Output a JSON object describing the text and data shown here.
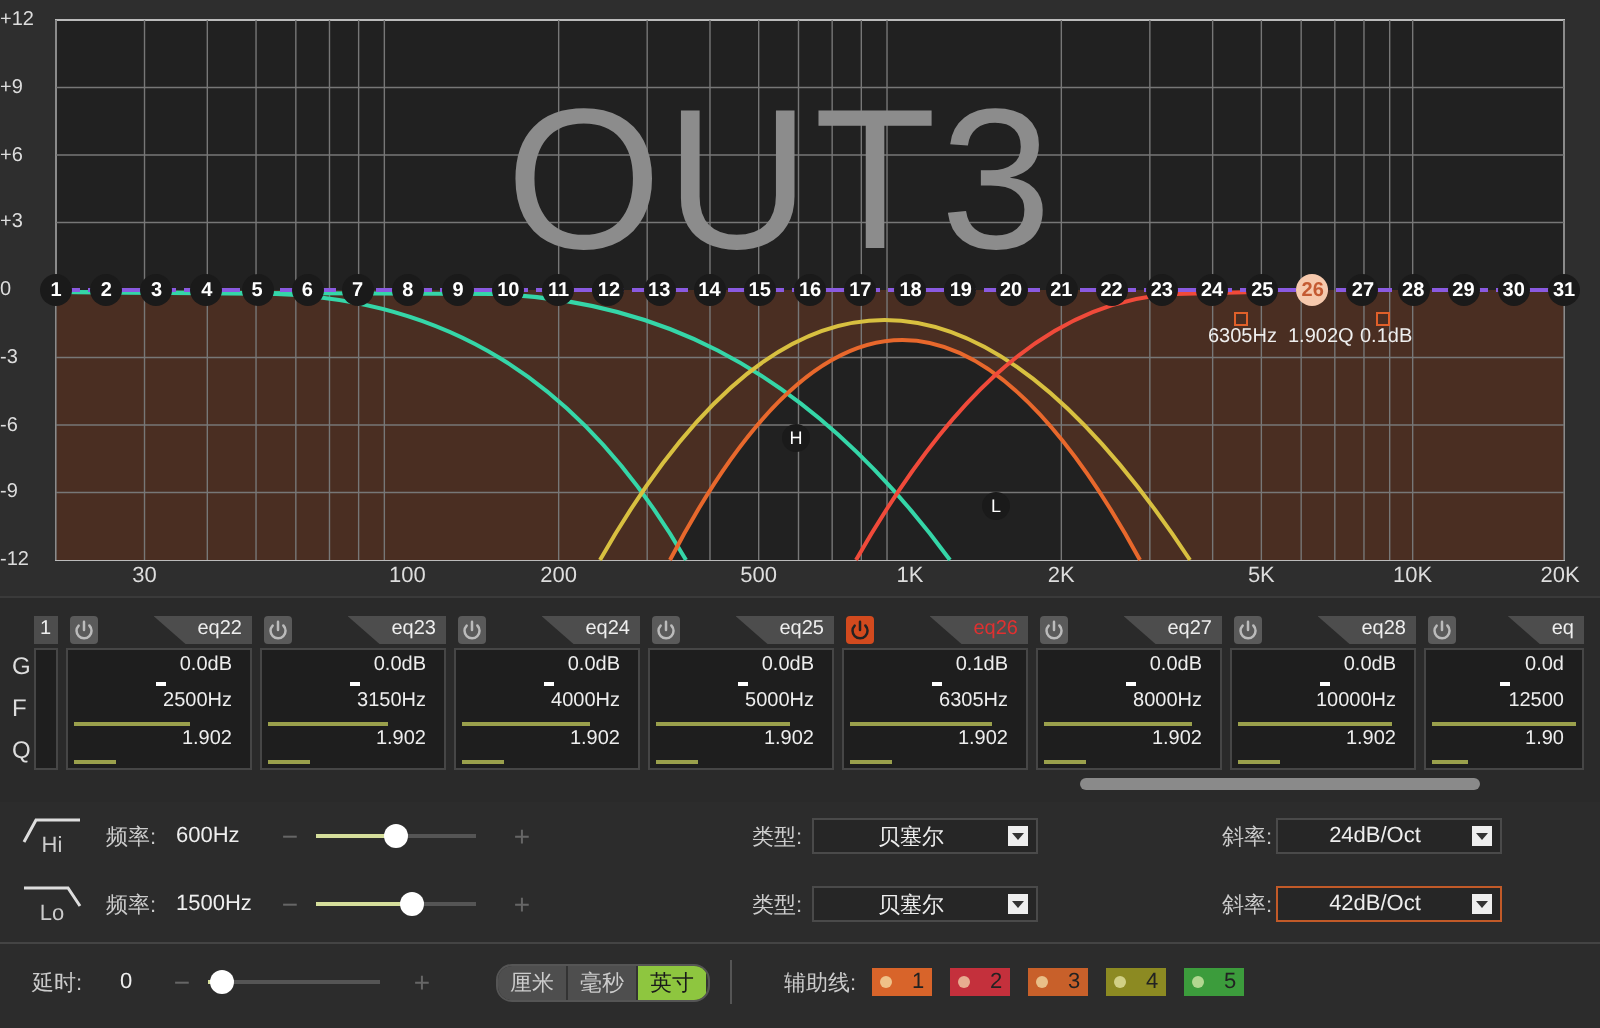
{
  "graph": {
    "channel_label": "OUT3",
    "y_ticks": [
      "+12",
      "+9",
      "+6",
      "+3",
      "0",
      "-3",
      "-6",
      "-9",
      "-12"
    ],
    "x_ticks": [
      "30",
      "100",
      "200",
      "500",
      "1K",
      "2K",
      "5K",
      "10K",
      "20K"
    ],
    "nodes": [
      {
        "label": "1",
        "selected": false
      },
      {
        "label": "2",
        "selected": false
      },
      {
        "label": "3",
        "selected": false
      },
      {
        "label": "4",
        "selected": false
      },
      {
        "label": "5",
        "selected": false
      },
      {
        "label": "6",
        "selected": false
      },
      {
        "label": "7",
        "selected": false
      },
      {
        "label": "8",
        "selected": false
      },
      {
        "label": "9",
        "selected": false
      },
      {
        "label": "10",
        "selected": false
      },
      {
        "label": "11",
        "selected": false
      },
      {
        "label": "12",
        "selected": false
      },
      {
        "label": "13",
        "selected": false
      },
      {
        "label": "14",
        "selected": false
      },
      {
        "label": "15",
        "selected": false
      },
      {
        "label": "16",
        "selected": false
      },
      {
        "label": "17",
        "selected": false
      },
      {
        "label": "18",
        "selected": false
      },
      {
        "label": "19",
        "selected": false
      },
      {
        "label": "20",
        "selected": false
      },
      {
        "label": "21",
        "selected": false
      },
      {
        "label": "22",
        "selected": false
      },
      {
        "label": "23",
        "selected": false
      },
      {
        "label": "24",
        "selected": false
      },
      {
        "label": "25",
        "selected": false
      },
      {
        "label": "26",
        "selected": true
      },
      {
        "label": "27",
        "selected": false
      },
      {
        "label": "28",
        "selected": false
      },
      {
        "label": "29",
        "selected": false
      },
      {
        "label": "30",
        "selected": false
      },
      {
        "label": "31",
        "selected": false
      }
    ],
    "readout": [
      "6305Hz",
      "1.902Q",
      "0.1dB"
    ],
    "markers": [
      {
        "label": "H"
      },
      {
        "label": "L"
      }
    ]
  },
  "eq_strip": {
    "row_labels": [
      "G",
      "F",
      "Q"
    ],
    "bands": [
      {
        "kind": "partial",
        "tab": "1"
      },
      {
        "kind": "full",
        "tab": "eq22",
        "selected": false,
        "gain": {
          "text": "0.0dB",
          "level": 0.5
        },
        "freq": {
          "text": "2500Hz",
          "level": 0.68
        },
        "q": {
          "text": "1.902",
          "level": 0.25
        }
      },
      {
        "kind": "full",
        "tab": "eq23",
        "selected": false,
        "gain": {
          "text": "0.0dB",
          "level": 0.5
        },
        "freq": {
          "text": "3150Hz",
          "level": 0.71
        },
        "q": {
          "text": "1.902",
          "level": 0.25
        }
      },
      {
        "kind": "full",
        "tab": "eq24",
        "selected": false,
        "gain": {
          "text": "0.0dB",
          "level": 0.5
        },
        "freq": {
          "text": "4000Hz",
          "level": 0.75
        },
        "q": {
          "text": "1.902",
          "level": 0.25
        }
      },
      {
        "kind": "full",
        "tab": "eq25",
        "selected": false,
        "gain": {
          "text": "0.0dB",
          "level": 0.5
        },
        "freq": {
          "text": "5000Hz",
          "level": 0.79
        },
        "q": {
          "text": "1.902",
          "level": 0.25
        }
      },
      {
        "kind": "full",
        "tab": "eq26",
        "selected": true,
        "gain": {
          "text": "0.1dB",
          "level": 0.5
        },
        "freq": {
          "text": "6305Hz",
          "level": 0.83
        },
        "q": {
          "text": "1.902",
          "level": 0.25
        }
      },
      {
        "kind": "full",
        "tab": "eq27",
        "selected": false,
        "gain": {
          "text": "0.0dB",
          "level": 0.5
        },
        "freq": {
          "text": "8000Hz",
          "level": 0.87
        },
        "q": {
          "text": "1.902",
          "level": 0.25
        }
      },
      {
        "kind": "full",
        "tab": "eq28",
        "selected": false,
        "gain": {
          "text": "0.0dB",
          "level": 0.5
        },
        "freq": {
          "text": "10000Hz",
          "level": 0.91
        },
        "q": {
          "text": "1.902",
          "level": 0.25
        }
      },
      {
        "kind": "full",
        "tab": "eq",
        "selected": false,
        "gain": {
          "text": "0.0d",
          "level": 0.5
        },
        "freq": {
          "text": "12500",
          "level": 1
        },
        "q": {
          "text": "1.90",
          "level": 0.25
        }
      }
    ]
  },
  "filters": [
    {
      "kind": "high",
      "label": "Hi",
      "freq_label": "频率:",
      "freq": "600Hz",
      "minus": "−",
      "plus": "+",
      "level": 0.5,
      "type_label": "类型:",
      "type": "贝塞尔",
      "slope_label": "斜率:",
      "slope": "24dB/Oct",
      "focused": false
    },
    {
      "kind": "low",
      "label": "Lo",
      "freq_label": "频率:",
      "freq": "1500Hz",
      "minus": "−",
      "plus": "+",
      "level": 0.6,
      "type_label": "类型:",
      "type": "贝塞尔",
      "slope_label": "斜率:",
      "slope": "42dB/Oct",
      "focused": true
    }
  ],
  "delay": {
    "label": "延时:",
    "value": "0",
    "minus": "−",
    "plus": "+",
    "level": 0.08,
    "units": [
      {
        "label": "厘米",
        "selected": false
      },
      {
        "label": "毫秒",
        "selected": false
      },
      {
        "label": "英寸",
        "selected": true
      }
    ]
  },
  "guides": {
    "label": "辅助线:",
    "buttons": [
      {
        "label": "1",
        "color": "#d8642a"
      },
      {
        "label": "2",
        "color": "#c4303c"
      },
      {
        "label": "3",
        "color": "#c8602a"
      },
      {
        "label": "4",
        "color": "#8c8a22"
      },
      {
        "label": "5",
        "color": "#3c9c3c"
      }
    ]
  }
}
